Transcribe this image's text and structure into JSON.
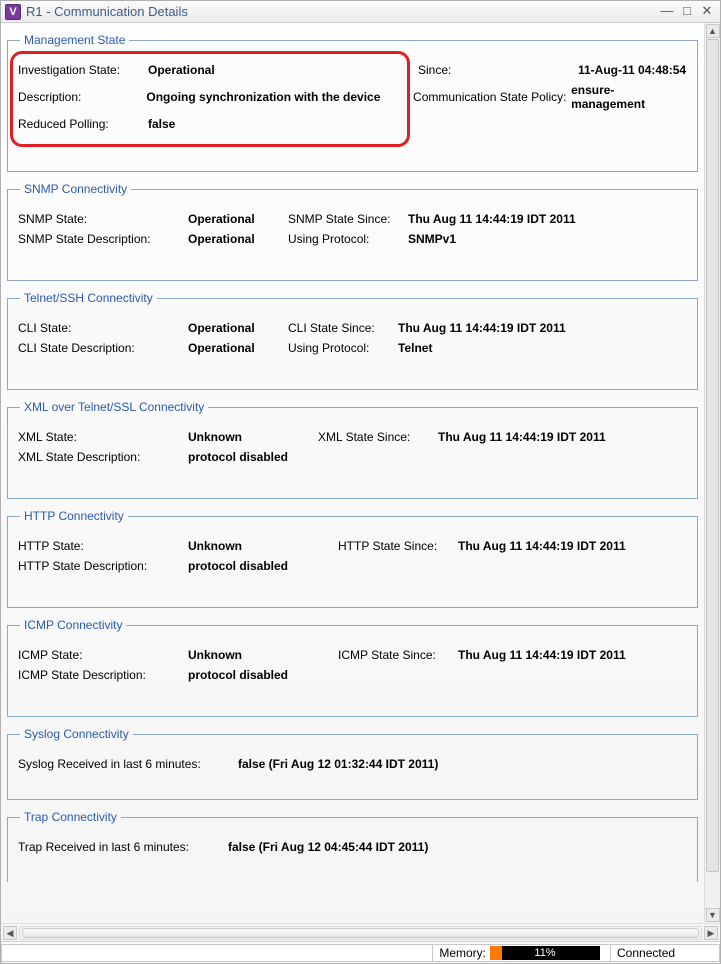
{
  "window": {
    "icon_letter": "V",
    "title": "R1  - Communication Details"
  },
  "groups": {
    "management": {
      "legend": "Management State",
      "investigation_state_label": "Investigation State:",
      "investigation_state_value": "Operational",
      "since_label": "Since:",
      "since_value": "11-Aug-11 04:48:54",
      "description_label": "Description:",
      "description_value": "Ongoing synchronization with the device",
      "policy_label": "Communication State Policy:",
      "policy_value": "ensure-management",
      "reduced_polling_label": "Reduced Polling:",
      "reduced_polling_value": "false"
    },
    "snmp": {
      "legend": "SNMP Connectivity",
      "state_label": "SNMP State:",
      "state_value": "Operational",
      "since_label": "SNMP State Since:",
      "since_value": "Thu Aug 11 14:44:19 IDT 2011",
      "desc_label": "SNMP State Description:",
      "desc_value": "Operational",
      "proto_label": "Using Protocol:",
      "proto_value": "SNMPv1"
    },
    "telnet": {
      "legend": "Telnet/SSH Connectivity",
      "state_label": "CLI State:",
      "state_value": "Operational",
      "since_label": "CLI State Since:",
      "since_value": "Thu Aug 11 14:44:19 IDT 2011",
      "desc_label": "CLI State Description:",
      "desc_value": "Operational",
      "proto_label": "Using Protocol:",
      "proto_value": "Telnet"
    },
    "xml": {
      "legend": "XML over Telnet/SSL Connectivity",
      "state_label": "XML State:",
      "state_value": "Unknown",
      "since_label": "XML State Since:",
      "since_value": "Thu Aug 11 14:44:19 IDT 2011",
      "desc_label": "XML State Description:",
      "desc_value": "protocol disabled"
    },
    "http": {
      "legend": "HTTP Connectivity",
      "state_label": "HTTP State:",
      "state_value": "Unknown",
      "since_label": "HTTP State Since:",
      "since_value": "Thu Aug 11 14:44:19 IDT 2011",
      "desc_label": "HTTP State Description:",
      "desc_value": "protocol disabled"
    },
    "icmp": {
      "legend": "ICMP Connectivity",
      "state_label": "ICMP State:",
      "state_value": "Unknown",
      "since_label": "ICMP State Since:",
      "since_value": "Thu Aug 11 14:44:19 IDT 2011",
      "desc_label": "ICMP State Description:",
      "desc_value": "protocol disabled"
    },
    "syslog": {
      "legend": "Syslog Connectivity",
      "recv_label": "Syslog Received in last 6 minutes:",
      "recv_value": "false (Fri Aug 12 01:32:44 IDT 2011)"
    },
    "trap": {
      "legend": "Trap Connectivity",
      "recv_label": "Trap Received in last 6 minutes:",
      "recv_value": "false (Fri Aug 12 04:45:44 IDT 2011)"
    }
  },
  "status": {
    "memory_label": "Memory:",
    "memory_pct_text": "11%",
    "memory_pct_num": 11,
    "connected": "Connected"
  },
  "side_id": "283578"
}
